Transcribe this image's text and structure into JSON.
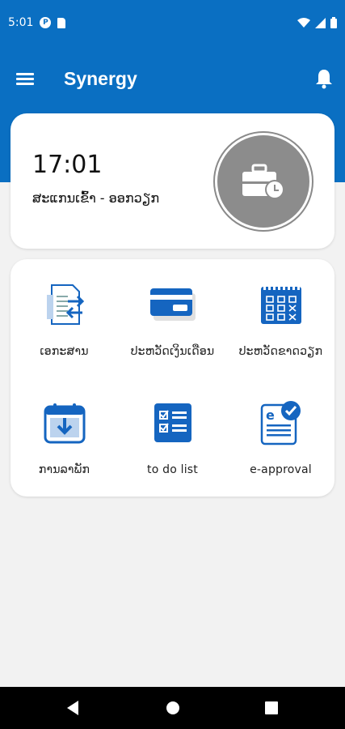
{
  "status_bar": {
    "time": "5:01",
    "notif_icon_letter": "P"
  },
  "app_bar": {
    "title": "Synergy"
  },
  "time_card": {
    "time": "17:01",
    "label": "ສະແກນເຂົ້າ - ອອກວຽກ"
  },
  "menu": {
    "items": [
      {
        "label": "ເອກະສານ",
        "icon": "document-transfer-icon"
      },
      {
        "label": "ປະຫວັດເງິນເດືອນ",
        "icon": "salary-card-icon"
      },
      {
        "label": "ປະຫວັດຂາດວຽກ",
        "icon": "absence-calendar-icon"
      },
      {
        "label": "ການລາພັກ",
        "icon": "leave-calendar-icon"
      },
      {
        "label": "to do list",
        "icon": "checklist-icon"
      },
      {
        "label": "e-approval",
        "icon": "e-approval-icon"
      }
    ]
  },
  "colors": {
    "primary": "#0a6fc2",
    "icon_blue": "#1565c0",
    "checkin_gray": "#8c8c8c"
  }
}
